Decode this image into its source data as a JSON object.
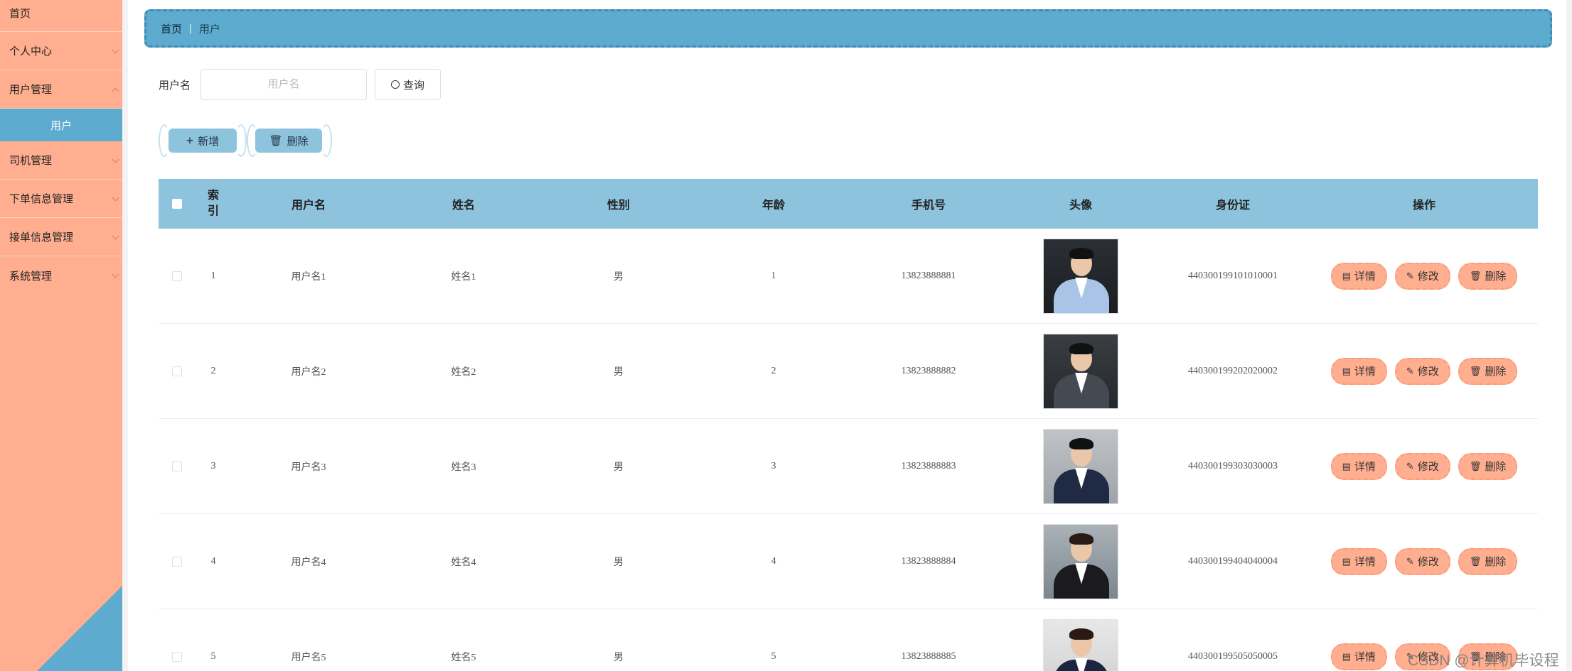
{
  "sidebar": {
    "items": [
      {
        "label": "首页"
      },
      {
        "label": "个人中心"
      },
      {
        "label": "用户管理"
      },
      {
        "label": "司机管理"
      },
      {
        "label": "下单信息管理"
      },
      {
        "label": "接单信息管理"
      },
      {
        "label": "系统管理"
      }
    ],
    "active_sub": "用户"
  },
  "breadcrumb": {
    "home": "首页",
    "separator": "|",
    "current": "用户"
  },
  "search": {
    "label": "用户名",
    "placeholder": "用户名",
    "button": "查询"
  },
  "actions": {
    "add": "新增",
    "delete": "删除"
  },
  "table": {
    "headers": [
      "索\n引",
      "用户名",
      "姓名",
      "性别",
      "年龄",
      "手机号",
      "头像",
      "身份证",
      "操作"
    ],
    "rows": [
      {
        "index": "1",
        "username": "用户名1",
        "name": "姓名1",
        "gender": "男",
        "age": "1",
        "phone": "13823888881",
        "id_card": "440300199101010001"
      },
      {
        "index": "2",
        "username": "用户名2",
        "name": "姓名2",
        "gender": "男",
        "age": "2",
        "phone": "13823888882",
        "id_card": "440300199202020002"
      },
      {
        "index": "3",
        "username": "用户名3",
        "name": "姓名3",
        "gender": "男",
        "age": "3",
        "phone": "13823888883",
        "id_card": "440300199303030003"
      },
      {
        "index": "4",
        "username": "用户名4",
        "name": "姓名4",
        "gender": "男",
        "age": "4",
        "phone": "13823888884",
        "id_card": "440300199404040004"
      },
      {
        "index": "5",
        "username": "用户名5",
        "name": "姓名5",
        "gender": "男",
        "age": "5",
        "phone": "13823888885",
        "id_card": "440300199505050005"
      }
    ],
    "row_actions": {
      "detail": "详情",
      "edit": "修改",
      "delete": "删除"
    }
  },
  "watermark": "CSDN @计算机毕设程序",
  "colors": {
    "sidebar": "#ffae8f",
    "accent_blue": "#5eabd0",
    "table_header": "#8ec3de",
    "op_button": "#ffae8f"
  }
}
